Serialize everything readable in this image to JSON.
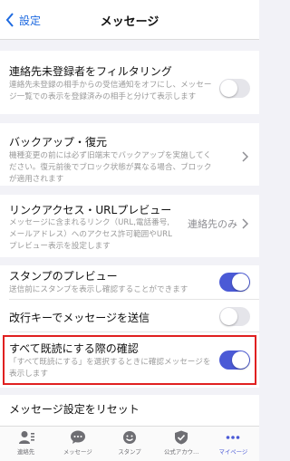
{
  "nav": {
    "back_label": "設定",
    "title": "メッセージ"
  },
  "rows": {
    "filter": {
      "title": "連絡先未登録者をフィルタリング",
      "desc": "連絡先未登録の相手からの受信通知をオフにし、メッセージ一覧での表示を登録済みの相手と分けて表示します",
      "enabled": false
    },
    "backup": {
      "title": "バックアップ・復元",
      "desc": "機種変更の前には必ず旧端末でバックアップを実施してください。復元前後でブロック状態が異なる場合、ブロックが適用されます"
    },
    "link_preview": {
      "title": "リンクアクセス・URLプレビュー",
      "desc": "メッセージに含まれるリンク（URL,電話番号,メールアドレス）へのアクセス許可範囲やURLプレビュー表示を設定します",
      "value": "連絡先のみ"
    },
    "stamp_preview": {
      "title": "スタンプのプレビュー",
      "desc": "送信前にスタンプを表示し確認することができます",
      "enabled": true
    },
    "enter_send": {
      "title": "改行キーでメッセージを送信",
      "enabled": false
    },
    "read_all_confirm": {
      "title": "すべて既読にする際の確認",
      "desc": "「すべて既読にする」を選択するときに確認メッセージを表示します",
      "enabled": true
    },
    "reset": {
      "title": "メッセージ設定をリセット"
    }
  },
  "tabs": [
    {
      "label": "連絡先",
      "icon": "contacts-icon"
    },
    {
      "label": "メッセージ",
      "icon": "message-icon"
    },
    {
      "label": "スタンプ",
      "icon": "stamp-icon"
    },
    {
      "label": "公式アカウ…",
      "icon": "official-account-icon"
    },
    {
      "label": "マイページ",
      "icon": "more-dots-icon",
      "active": true
    }
  ],
  "colors": {
    "accent": "#4b5ad6",
    "link": "#1e6ae0",
    "highlight": "#e02020"
  }
}
